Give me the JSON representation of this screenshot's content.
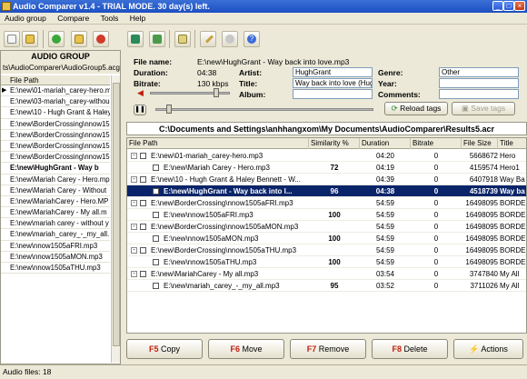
{
  "window": {
    "title": "Audio Comparer v1.4 - TRIAL MODE. 30 day(s) left."
  },
  "menu": [
    "Audio group",
    "Compare",
    "Tools",
    "Help"
  ],
  "group_panel": {
    "title": "AUDIO GROUP",
    "file": "ts\\AudioComparer\\AudioGroup5.acg",
    "column": "File Path",
    "items": [
      "E:\\new\\01-mariah_carey-hero.m",
      "E:\\new\\03-mariah_carey-withou",
      "E:\\new\\10 - Hugh Grant & Haley",
      "E:\\new\\BorderCrossing\\nnow15",
      "E:\\new\\BorderCrossing\\nnow15",
      "E:\\new\\BorderCrossing\\nnow15",
      "E:\\new\\BorderCrossing\\nnow15",
      "E:\\new\\HughGrant - Way b",
      "E:\\new\\Mariah Carey - Hero.mp",
      "E:\\new\\Mariah Carey - Without",
      "E:\\new\\MariahCarey - Hero.MP",
      "E:\\new\\MariahCarey - My all.m",
      "E:\\new\\mariah carey - without y",
      "E:\\new\\mariah_carey_-_my_all.",
      "E:\\new\\nnow1505aFRI.mp3",
      "E:\\new\\nnow1505aMON.mp3",
      "E:\\new\\nnow1505aTHU.mp3"
    ]
  },
  "info": {
    "file_name_label": "File name:",
    "file_name": "E:\\new\\HughGrant - Way back into love.mp3",
    "duration_label": "Duration:",
    "duration": "04:38",
    "bitrate_label": "Bitrate:",
    "bitrate": "130 kbps",
    "artist_label": "Artist:",
    "artist": "HughGrant",
    "title_label": "Title:",
    "title": "Way back into love (Hug",
    "album_label": "Album:",
    "album": "",
    "genre_label": "Genre:",
    "genre": "Other",
    "year_label": "Year:",
    "year": "",
    "comments_label": "Comments:",
    "comments": "",
    "reload_tags": "Reload tags",
    "save_tags": "Save tags",
    "volume_level": 0.85,
    "position_level": 0.05
  },
  "results_path": "C:\\Documents and Settings\\anhhangxom\\My Documents\\AudioComparer\\Results5.acr",
  "grid": {
    "columns": [
      "File Path",
      "Similarity %",
      "Duration",
      "Bitrate",
      "File Size",
      "Title"
    ],
    "rows": [
      {
        "path": "E:\\new\\01-mariah_carey-hero.mp3",
        "similarity": "",
        "duration": "04:20",
        "bitrate": "0",
        "size": "5668672",
        "title": "Hero",
        "level": 0,
        "expander": "-",
        "selected": false
      },
      {
        "path": "E:\\new\\Mariah Carey - Hero.mp3",
        "similarity": "72",
        "duration": "04:19",
        "bitrate": "0",
        "size": "4159574",
        "title": "Hero1",
        "level": 1,
        "expander": "",
        "selected": false
      },
      {
        "path": "E:\\new\\10 - Hugh Grant & Haley Bennett - W...",
        "similarity": "",
        "duration": "04:39",
        "bitrate": "0",
        "size": "6407918",
        "title": "Way Ba",
        "level": 0,
        "expander": "-",
        "selected": false
      },
      {
        "path": "E:\\new\\HughGrant - Way back into l...",
        "similarity": "96",
        "duration": "04:38",
        "bitrate": "0",
        "size": "4518739",
        "title": "Way ba",
        "level": 1,
        "expander": "",
        "selected": true
      },
      {
        "path": "E:\\new\\BorderCrossing\\nnow1505aFRI.mp3",
        "similarity": "",
        "duration": "54:59",
        "bitrate": "0",
        "size": "16498095",
        "title": "BORDER",
        "level": 0,
        "expander": "-",
        "selected": false
      },
      {
        "path": "E:\\new\\nnow1505aFRI.mp3",
        "similarity": "100",
        "duration": "54:59",
        "bitrate": "0",
        "size": "16498095",
        "title": "BORDER",
        "level": 1,
        "expander": "",
        "selected": false
      },
      {
        "path": "E:\\new\\BorderCrossing\\nnow1505aMON.mp3",
        "similarity": "",
        "duration": "54:59",
        "bitrate": "0",
        "size": "16498095",
        "title": "BORDER",
        "level": 0,
        "expander": "-",
        "selected": false
      },
      {
        "path": "E:\\new\\nnow1505aMON.mp3",
        "similarity": "100",
        "duration": "54:59",
        "bitrate": "0",
        "size": "16498095",
        "title": "BORDER",
        "level": 1,
        "expander": "",
        "selected": false
      },
      {
        "path": "E:\\new\\BorderCrossing\\nnow1505aTHU.mp3",
        "similarity": "",
        "duration": "54:59",
        "bitrate": "0",
        "size": "16498095",
        "title": "BORDER",
        "level": 0,
        "expander": "-",
        "selected": false
      },
      {
        "path": "E:\\new\\nnow1505aTHU.mp3",
        "similarity": "100",
        "duration": "54:59",
        "bitrate": "0",
        "size": "16498095",
        "title": "BORDER",
        "level": 1,
        "expander": "",
        "selected": false
      },
      {
        "path": "E:\\new\\MariahCarey - My all.mp3",
        "similarity": "",
        "duration": "03:54",
        "bitrate": "0",
        "size": "3747840",
        "title": "My All",
        "level": 0,
        "expander": "-",
        "selected": false
      },
      {
        "path": "E:\\new\\mariah_carey_-_my_all.mp3",
        "similarity": "95",
        "duration": "03:52",
        "bitrate": "0",
        "size": "3711026",
        "title": "My All",
        "level": 1,
        "expander": "",
        "selected": false
      }
    ]
  },
  "actions": [
    {
      "key": "F5",
      "label": "Copy"
    },
    {
      "key": "F6",
      "label": "Move"
    },
    {
      "key": "F7",
      "label": "Remove"
    },
    {
      "key": "F8",
      "label": "Delete"
    },
    {
      "key": "",
      "label": "Actions"
    }
  ],
  "status": "Audio files: 18",
  "toolbar_icons": [
    "new-group-icon",
    "open-group-icon",
    "add-file-icon",
    "add-folder-icon",
    "remove-icon",
    "compare-icon",
    "chart-icon",
    "tags-icon",
    "wand-icon",
    "settings-icon",
    "help-icon"
  ],
  "colors": {
    "selection": "#0a246a",
    "title_bar": "#1d4fc2",
    "action_key": "#c02010"
  }
}
